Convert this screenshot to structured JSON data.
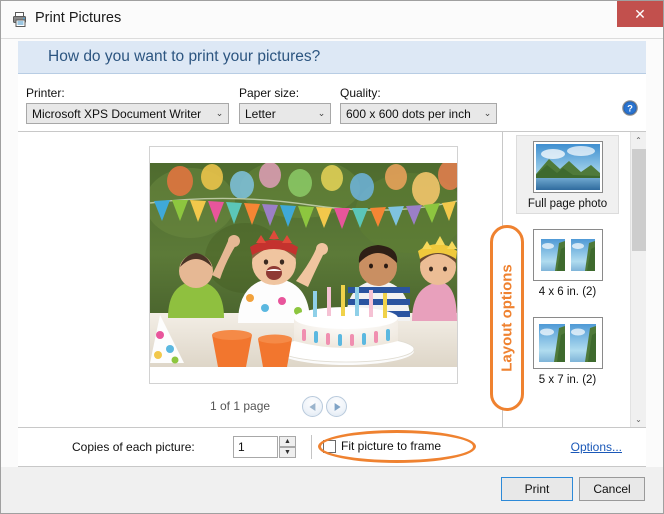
{
  "window": {
    "title": "Print Pictures",
    "title_icon": "printer-icon",
    "close_label": "✕"
  },
  "header": {
    "question": "How do you want to print your pictures?",
    "help_icon": "help-icon",
    "band_color": "#dde8f5",
    "text_color": "#2c5580"
  },
  "options_strip": {
    "printer": {
      "label": "Printer:",
      "value": "Microsoft XPS Document Writer",
      "arrow": "⌄"
    },
    "paper_size": {
      "label": "Paper size:",
      "value": "Letter",
      "arrow": "⌄"
    },
    "quality": {
      "label": "Quality:",
      "value": "600 x 600 dots per inch",
      "arrow": "⌄"
    }
  },
  "preview": {
    "photo_description": "birthday-party-children-cake-photo",
    "page_counter": "1 of 1 page",
    "prev_icon": "triangle-left-icon",
    "next_icon": "triangle-right-icon"
  },
  "layout_options": {
    "callout_label": "Layout options",
    "callout_color": "#ef8230",
    "items": [
      {
        "label": "Full page photo",
        "thumb": "landscape-single-thumb",
        "selected": true
      },
      {
        "label": "4 x 6 in. (2)",
        "thumb": "landscape-pair-thumb",
        "selected": false
      },
      {
        "label": "5 x 7 in. (2)",
        "thumb": "landscape-pair-thumb",
        "selected": false
      }
    ],
    "scrollbar": {
      "up_arrow": "⌃",
      "down_arrow": "⌄"
    }
  },
  "copies_strip": {
    "copies_label": "Copies of each picture:",
    "copies_value": "1",
    "spin_up": "▲",
    "spin_down": "▼",
    "fit_checkbox_label": "Fit picture to frame",
    "fit_checked": false,
    "highlight_color": "#ef8230",
    "options_link": "Options..."
  },
  "footer": {
    "print_label": "Print",
    "cancel_label": "Cancel",
    "print_focus_color": "#2d8ad8"
  }
}
